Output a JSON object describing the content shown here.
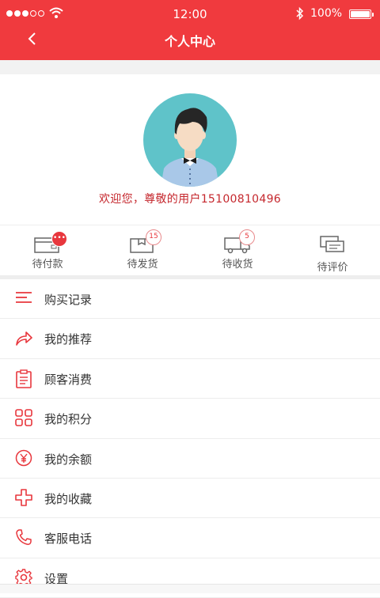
{
  "status_bar": {
    "time": "12:00",
    "battery": "100%",
    "battery_level": 1.0
  },
  "header": {
    "title": "个人中心"
  },
  "profile": {
    "welcome": "欢迎您，尊敬的用户15100810496"
  },
  "orders": [
    {
      "label": "待付款",
      "icon": "wallet-icon",
      "badge": "•••"
    },
    {
      "label": "待发货",
      "icon": "package-icon",
      "badge": "15"
    },
    {
      "label": "待收货",
      "icon": "truck-icon",
      "badge": "5"
    },
    {
      "label": "待评价",
      "icon": "comment-icon",
      "badge": ""
    }
  ],
  "menu": [
    {
      "label": "购买记录",
      "icon": "list-icon"
    },
    {
      "label": "我的推荐",
      "icon": "share-icon"
    },
    {
      "label": "顾客消费",
      "icon": "clipboard-icon"
    },
    {
      "label": "我的积分",
      "icon": "grid-icon"
    },
    {
      "label": "我的余额",
      "icon": "yen-icon"
    },
    {
      "label": "我的收藏",
      "icon": "plus-icon"
    },
    {
      "label": "客服电话",
      "icon": "phone-icon"
    },
    {
      "label": "设置",
      "icon": "gear-icon"
    }
  ],
  "colors": {
    "primary": "#f03a3e",
    "accent_text": "#c5272d",
    "background": "#f2f2f2"
  }
}
